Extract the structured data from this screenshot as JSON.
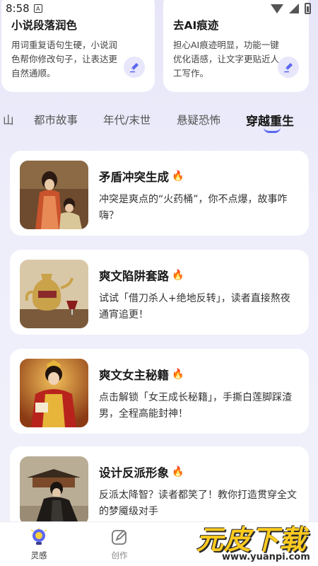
{
  "status_bar": {
    "time": "8:58",
    "notification_glyph": "A"
  },
  "features": [
    {
      "title": "小说段落润色",
      "desc": "用词重复语句生硬，小说润色帮你修改句子，让表达更自然通顺。"
    },
    {
      "title": "去AI痕迹",
      "desc": "担心AI痕迹明显，功能一键优化语感，让文字更贴近人工写作。"
    }
  ],
  "tabs": [
    "山",
    "都市故事",
    "年代/末世",
    "悬疑恐怖",
    "穿越重生"
  ],
  "active_tab": "穿越重生",
  "articles": [
    {
      "title": "矛盾冲突生成",
      "desc": "冲突是爽点的“火药桶”，你不点爆，故事咋嗨？"
    },
    {
      "title": "爽文陷阱套路",
      "desc": "试试「借刀杀人+绝地反转」，读者直接熬夜通宵追更！"
    },
    {
      "title": "爽文女主秘籍",
      "desc": "点击解锁「女王成长秘籍」，手撕白莲脚踩渣男，全程高能封神！"
    },
    {
      "title": "设计反派形象",
      "desc": "反派太降智？读者都笑了！教你打造贯穿全文的梦魇级对手"
    }
  ],
  "title_emoji": "🔥",
  "nav": [
    {
      "label": "灵感",
      "icon": "lightbulb-icon"
    },
    {
      "label": "创作",
      "icon": "edit-icon"
    }
  ],
  "watermark": {
    "text": "元皮下载",
    "url": "www.yuanpi.com"
  },
  "colors": {
    "accent": "#5b67f0",
    "card": "#ffffff",
    "background": "#ececf9"
  }
}
